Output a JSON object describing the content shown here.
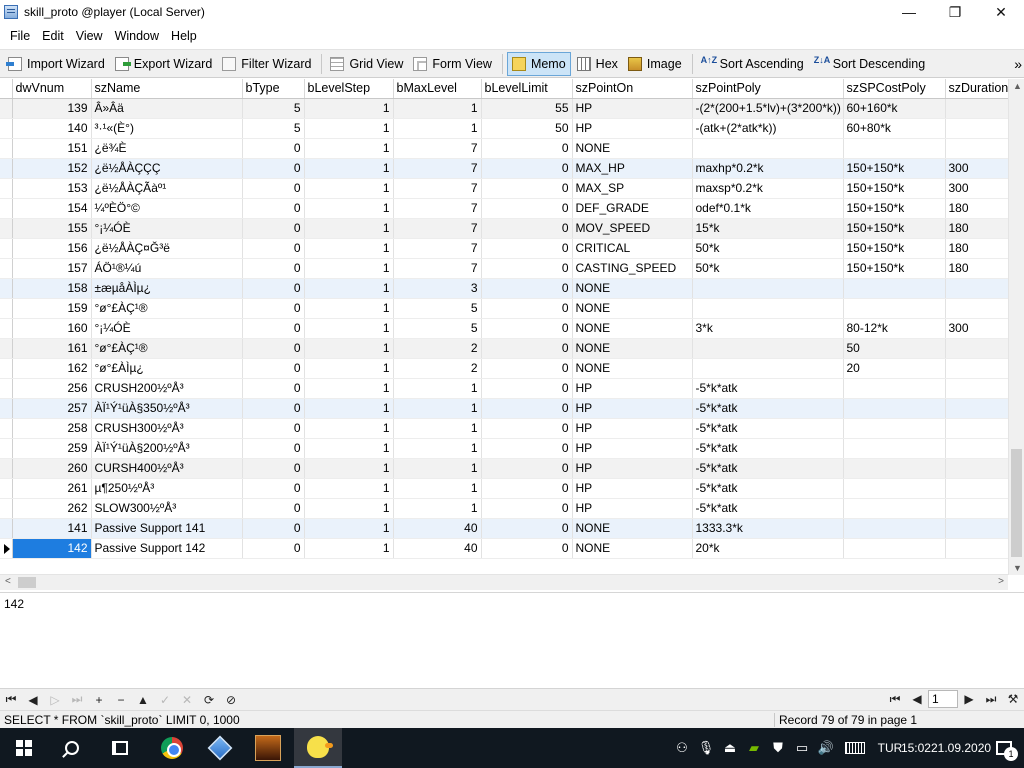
{
  "window": {
    "title": "skill_proto @player (Local Server)",
    "min": "—",
    "max": "❐",
    "close": "✕"
  },
  "menu": [
    "File",
    "Edit",
    "View",
    "Window",
    "Help"
  ],
  "toolbar": {
    "import": "Import Wizard",
    "export": "Export Wizard",
    "filter": "Filter Wizard",
    "grid": "Grid View",
    "form": "Form View",
    "memo": "Memo",
    "hex": "Hex",
    "image": "Image",
    "sort_asc": "Sort Ascending",
    "sort_desc": "Sort Descending",
    "sort_asc_glyph": "A↑Z",
    "sort_desc_glyph": "Z↓A",
    "overflow": "»"
  },
  "columns": [
    "dwVnum",
    "szName",
    "bType",
    "bLevelStep",
    "bMaxLevel",
    "bLevelLimit",
    "szPointOn",
    "szPointPoly",
    "szSPCostPoly",
    "szDuration"
  ],
  "rows": [
    [
      "139",
      "Â»Âä",
      "5",
      "1",
      "1",
      "55",
      "HP",
      "-(2*(200+1.5*lv)+(3*200*k))",
      "60+160*k",
      ""
    ],
    [
      "140",
      "³·¹«(È°)",
      "5",
      "1",
      "1",
      "50",
      "HP",
      "-(atk+(2*atk*k))",
      "60+80*k",
      ""
    ],
    [
      "151",
      "¿ë¾È",
      "0",
      "1",
      "7",
      "0",
      "NONE",
      "",
      "",
      ""
    ],
    [
      "152",
      "¿ë½ÅÀÇÇÇ",
      "0",
      "1",
      "7",
      "0",
      "MAX_HP",
      "maxhp*0.2*k",
      "150+150*k",
      "300"
    ],
    [
      "153",
      "¿ë½ÅÀÇÃàº¹",
      "0",
      "1",
      "7",
      "0",
      "MAX_SP",
      "maxsp*0.2*k",
      "150+150*k",
      "300"
    ],
    [
      "154",
      "¼ºÈÖ°©",
      "0",
      "1",
      "7",
      "0",
      "DEF_GRADE",
      "odef*0.1*k",
      "150+150*k",
      "180"
    ],
    [
      "155",
      "°¡¼ÓÈ­",
      "0",
      "1",
      "7",
      "0",
      "MOV_SPEED",
      "15*k",
      "150+150*k",
      "180"
    ],
    [
      "156",
      "¿ë½ÅÀÇ¤Ğ³ë",
      "0",
      "1",
      "7",
      "0",
      "CRITICAL",
      "50*k",
      "150+150*k",
      "180"
    ],
    [
      "157",
      "ÁÖ¹®¼ú",
      "0",
      "1",
      "7",
      "0",
      "CASTING_SPEED",
      "50*k",
      "150+150*k",
      "180"
    ],
    [
      "158",
      "±æµåÀÌµ¿",
      "0",
      "1",
      "3",
      "0",
      "NONE",
      "",
      "",
      ""
    ],
    [
      "159",
      "°ø°£ÀÇ¹®",
      "0",
      "1",
      "5",
      "0",
      "NONE",
      "",
      "",
      ""
    ],
    [
      "160",
      "°¡¼ÓÈ­",
      "0",
      "1",
      "5",
      "0",
      "NONE",
      "3*k",
      "80-12*k",
      "300"
    ],
    [
      "161",
      "°ø°£ÀÇ¹®",
      "0",
      "1",
      "2",
      "0",
      "NONE",
      "",
      "50",
      ""
    ],
    [
      "162",
      "°ø°£ÀÌµ¿",
      "0",
      "1",
      "2",
      "0",
      "NONE",
      "",
      "20",
      ""
    ],
    [
      "256",
      "CRUSH200½ºÅ³",
      "0",
      "1",
      "1",
      "0",
      "HP",
      "-5*k*atk",
      "",
      ""
    ],
    [
      "257",
      "ÀÏ¹Ý¹üÀ§350½ºÅ³",
      "0",
      "1",
      "1",
      "0",
      "HP",
      "-5*k*atk",
      "",
      ""
    ],
    [
      "258",
      "CRUSH300½ºÅ³",
      "0",
      "1",
      "1",
      "0",
      "HP",
      "-5*k*atk",
      "",
      ""
    ],
    [
      "259",
      "ÀÏ¹Ý¹üÀ§200½ºÅ³",
      "0",
      "1",
      "1",
      "0",
      "HP",
      "-5*k*atk",
      "",
      ""
    ],
    [
      "260",
      "CURSH400½ºÅ³",
      "0",
      "1",
      "1",
      "0",
      "HP",
      "-5*k*atk",
      "",
      ""
    ],
    [
      "261",
      "µ¶250½ºÅ³",
      "0",
      "1",
      "1",
      "0",
      "HP",
      "-5*k*atk",
      "",
      ""
    ],
    [
      "262",
      "SLOW300½ºÅ³",
      "0",
      "1",
      "1",
      "0",
      "HP",
      "-5*k*atk",
      "",
      ""
    ],
    [
      "141",
      "Passive Support 141",
      "0",
      "1",
      "40",
      "0",
      "NONE",
      "1333.3*k",
      "",
      ""
    ],
    [
      "142",
      "Passive Support 142",
      "0",
      "1",
      "40",
      "0",
      "NONE",
      "20*k",
      "",
      ""
    ]
  ],
  "selected_row_index": 22,
  "memo": {
    "value": "142"
  },
  "navigator": {
    "first": "⏮",
    "prev": "◀",
    "next": "▷",
    "last": "⏭",
    "insert": "+",
    "delete": "−",
    "up": "▲",
    "apply": "✓",
    "cancel": "✕",
    "refresh": "⟳",
    "stop": "⊘",
    "page": "1"
  },
  "status": {
    "sql": "SELECT * FROM `skill_proto` LIMIT 0, 1000",
    "record": "Record 79 of 79 in page 1"
  },
  "taskbar": {
    "lang": "TUR",
    "time": "15:02",
    "date": "21.09.2020",
    "notifications": "1"
  }
}
